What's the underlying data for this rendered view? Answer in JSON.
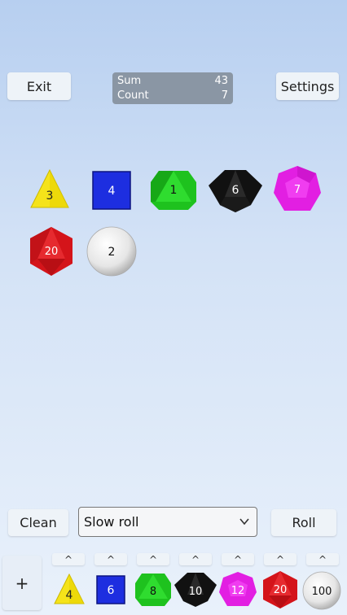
{
  "header": {
    "exit_label": "Exit",
    "settings_label": "Settings",
    "sum_label": "Sum",
    "sum_value": "43",
    "count_label": "Count",
    "count_value": "7"
  },
  "rolled_dice": [
    {
      "type": "d4",
      "value": "3",
      "color": "#f5e31a"
    },
    {
      "type": "d6",
      "value": "4",
      "color": "#1d2ee0"
    },
    {
      "type": "d8",
      "value": "1",
      "color": "#1ec21e"
    },
    {
      "type": "d10",
      "value": "6",
      "color": "#111111"
    },
    {
      "type": "d12",
      "value": "7",
      "color": "#e21fe2"
    },
    {
      "type": "d20",
      "value": "20",
      "color": "#d4141a"
    },
    {
      "type": "d100",
      "value": "2",
      "color": "#f2f2f2"
    }
  ],
  "controls": {
    "clean_label": "Clean",
    "roll_mode_selected": "Slow roll",
    "roll_label": "Roll"
  },
  "tray": {
    "plus_label": "+",
    "up_label": "^",
    "dice": [
      {
        "type": "d4",
        "label": "4",
        "color": "#f5e31a"
      },
      {
        "type": "d6",
        "label": "6",
        "color": "#1d2ee0"
      },
      {
        "type": "d8",
        "label": "8",
        "color": "#1ec21e"
      },
      {
        "type": "d10",
        "label": "10",
        "color": "#111111"
      },
      {
        "type": "d12",
        "label": "12",
        "color": "#e21fe2"
      },
      {
        "type": "d20",
        "label": "20",
        "color": "#d4141a"
      },
      {
        "type": "d100",
        "label": "100",
        "color": "#f2f2f2"
      }
    ]
  }
}
